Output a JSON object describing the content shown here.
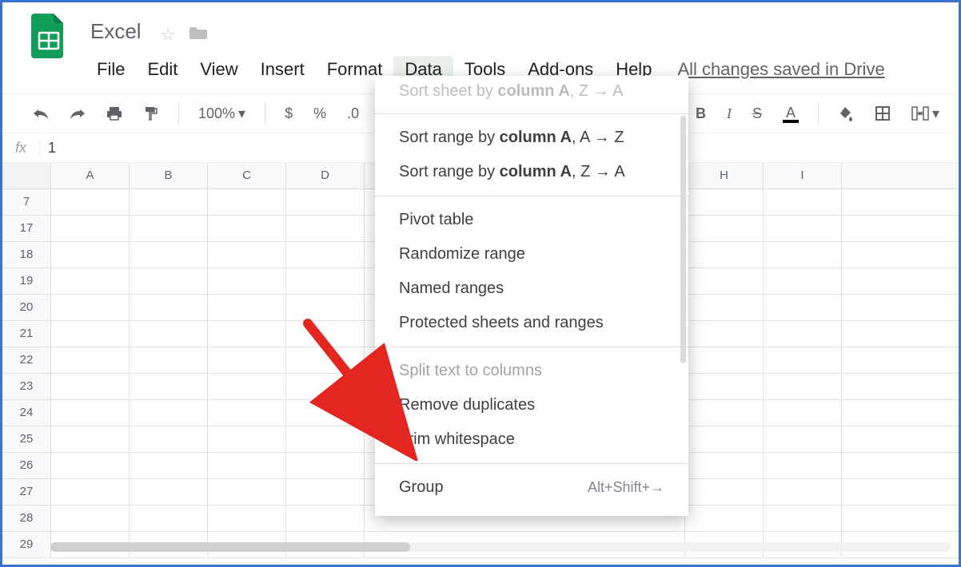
{
  "doc": {
    "title": "Excel",
    "drive_status": "All changes saved in Drive"
  },
  "menu": {
    "file": "File",
    "edit": "Edit",
    "view": "View",
    "insert": "Insert",
    "format": "Format",
    "data": "Data",
    "tools": "Tools",
    "addons": "Add-ons",
    "help": "Help"
  },
  "toolbar": {
    "zoom": "100%",
    "currency": "$",
    "percent": "%",
    "dec_dec": ".0",
    "bold": "B",
    "italic": "I",
    "strike": "S",
    "font_color": "A"
  },
  "fx": {
    "label": "fx",
    "value": "1"
  },
  "columns": [
    "A",
    "B",
    "C",
    "D",
    "",
    "H",
    "I"
  ],
  "row_headers": [
    "7",
    "17",
    "18",
    "19",
    "20",
    "21",
    "22",
    "23",
    "24",
    "25",
    "26",
    "27",
    "28",
    "29"
  ],
  "dropdown": {
    "cut_sort_sheet_prefix": "Sort sheet by ",
    "cut_sort_sheet_col": "column A",
    "cut_sort_sheet_suffix": ", Z → A",
    "sort_range_az_prefix": "Sort range by ",
    "sort_range_az_col": "column A",
    "sort_range_az_suffix": ", A → Z",
    "sort_range_za_prefix": "Sort range by ",
    "sort_range_za_col": "column A",
    "sort_range_za_suffix": ", Z → A",
    "pivot": "Pivot table",
    "randomize": "Randomize range",
    "named": "Named ranges",
    "protected": "Protected sheets and ranges",
    "split": "Split text to columns",
    "remove_dup": "Remove duplicates",
    "trim": "Trim whitespace",
    "group": "Group",
    "group_kbd": "Alt+Shift+→"
  },
  "arrow_color": "#e52620"
}
